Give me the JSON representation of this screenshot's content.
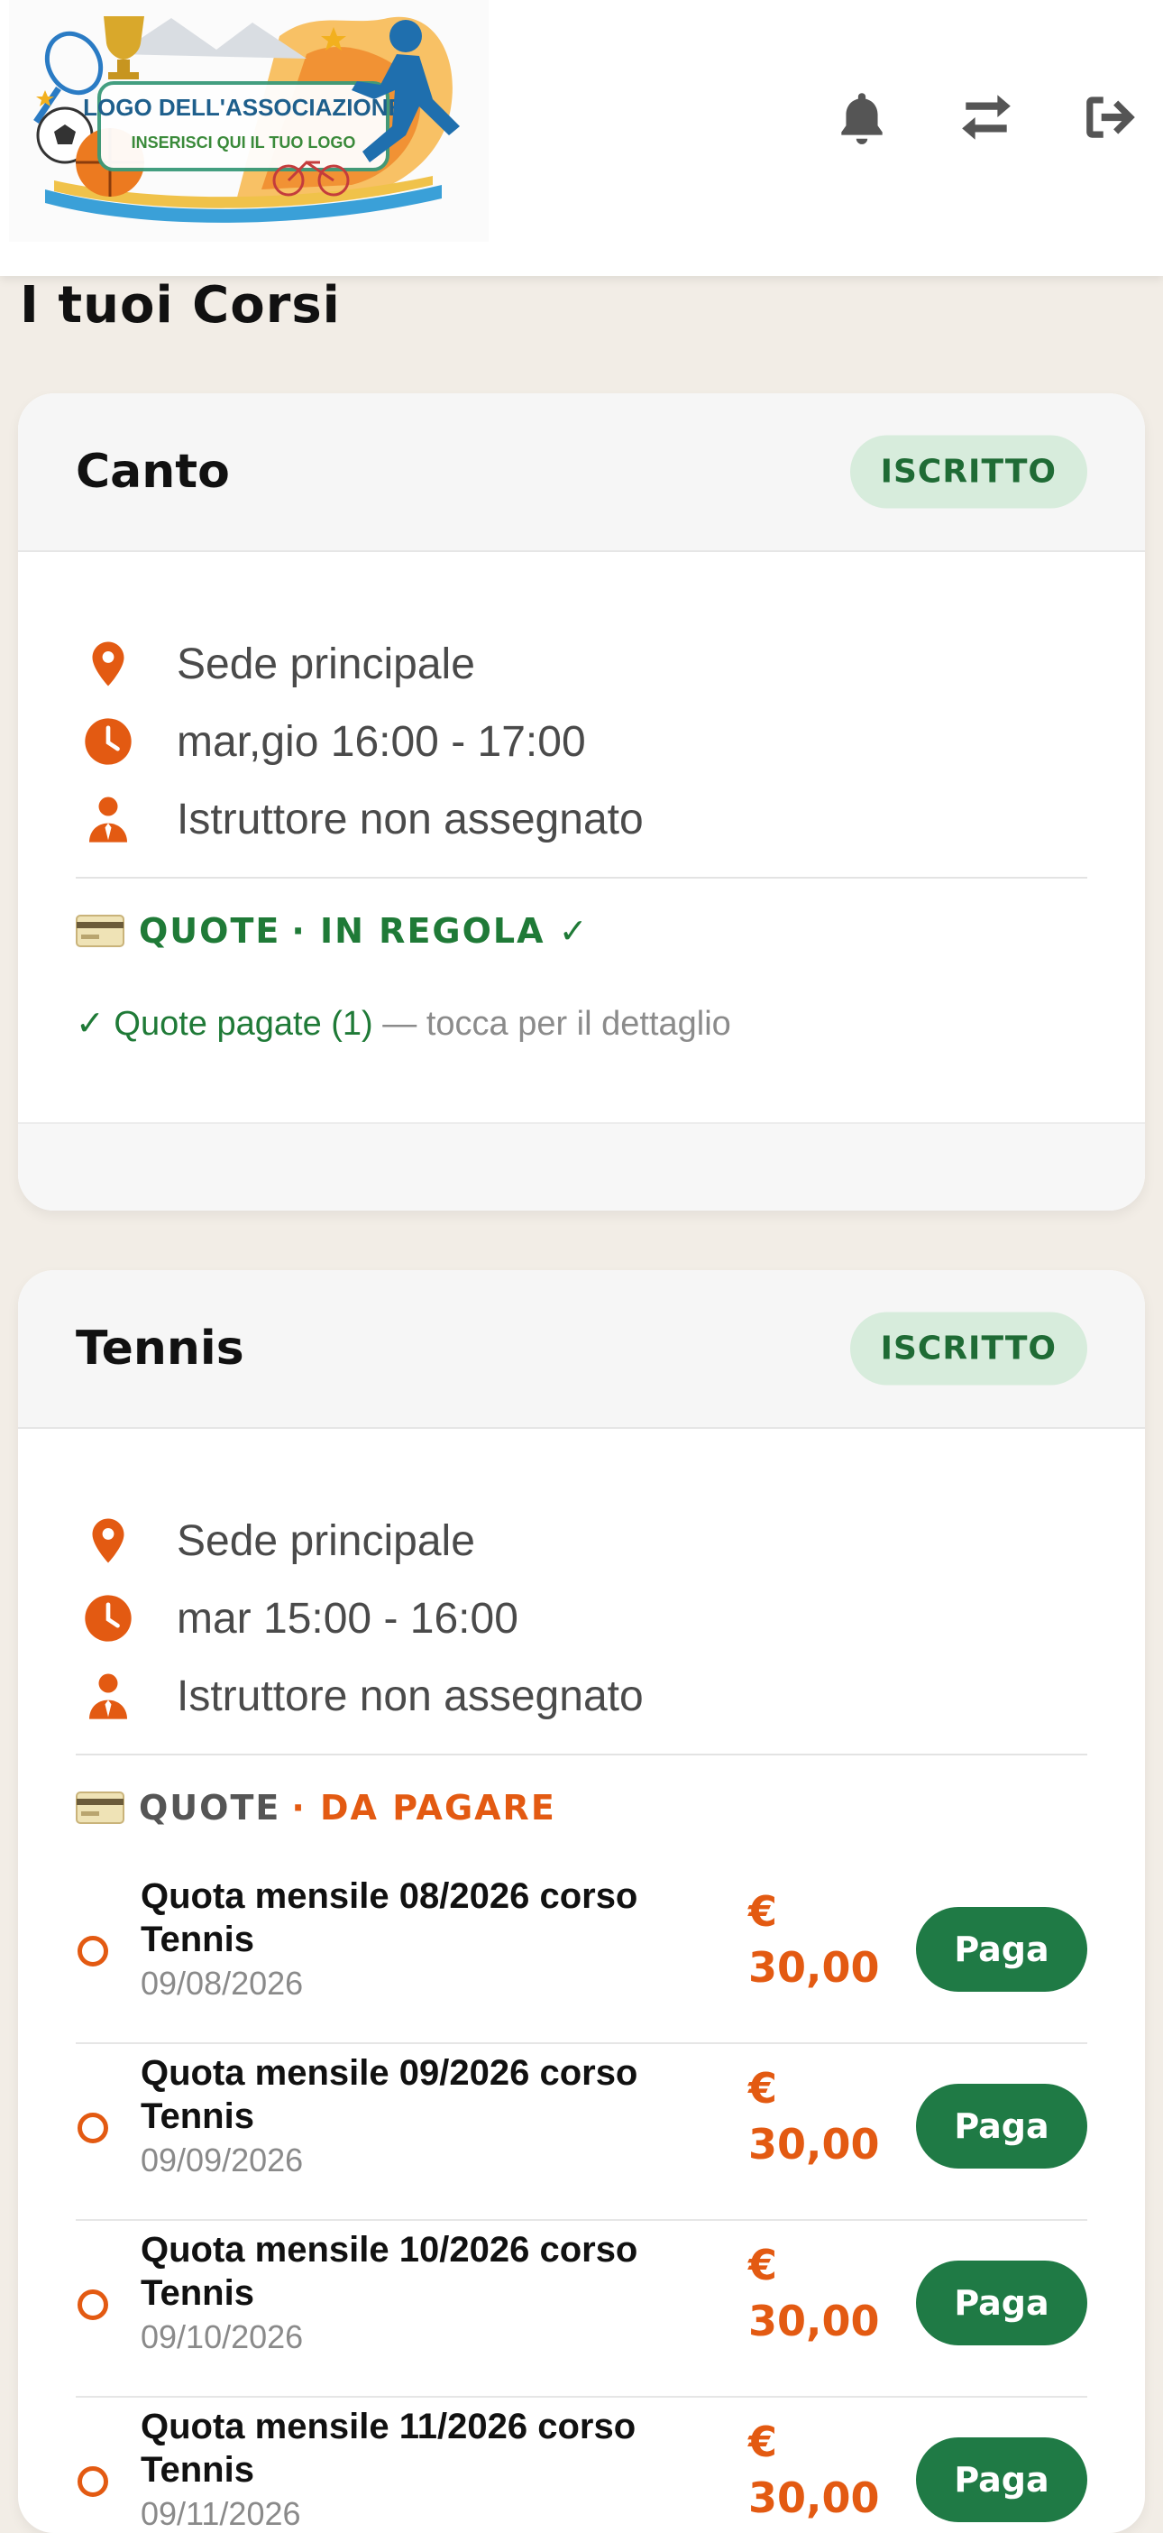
{
  "header": {
    "logo": {
      "title": "LOGO DELL'ASSOCIAZIONE",
      "subtitle": "INSERISCI QUI IL TUO LOGO"
    },
    "icons": [
      "bell-icon",
      "swap-icon",
      "logout-icon"
    ]
  },
  "page": {
    "title": "I tuoi Corsi"
  },
  "courses": [
    {
      "name": "Canto",
      "status": "ISCRITTO",
      "location": "Sede principale",
      "schedule": "mar,gio 16:00 - 17:00",
      "instructor": "Istruttore non assegnato",
      "quote_label": "QUOTE",
      "quote_status": "· IN REGOLA ✓",
      "paid_summary": "✓ Quote pagate (1)",
      "paid_hint": " — tocca per il dettaglio"
    },
    {
      "name": "Tennis",
      "status": "ISCRITTO",
      "location": "Sede principale",
      "schedule": "mar 15:00 - 16:00",
      "instructor": "Istruttore non assegnato",
      "quote_label": "QUOTE",
      "quote_status": "· DA PAGARE",
      "installments": [
        {
          "title": "Quota mensile 08/2026 corso Tennis",
          "date": "09/08/2026",
          "amount": "€ 30,00",
          "action": "Paga"
        },
        {
          "title": "Quota mensile 09/2026 corso Tennis",
          "date": "09/09/2026",
          "amount": "€ 30,00",
          "action": "Paga"
        },
        {
          "title": "Quota mensile 10/2026 corso Tennis",
          "date": "09/10/2026",
          "amount": "€ 30,00",
          "action": "Paga"
        },
        {
          "title": "Quota mensile 11/2026 corso Tennis",
          "date": "09/11/2026",
          "amount": "€ 30,00",
          "action": "Paga"
        }
      ]
    }
  ],
  "colors": {
    "accent_orange": "#e35a12",
    "success_green": "#1f7a37",
    "button_green": "#1f7a45",
    "badge_bg": "#d7ecdc",
    "page_bg": "#f2ede6"
  }
}
